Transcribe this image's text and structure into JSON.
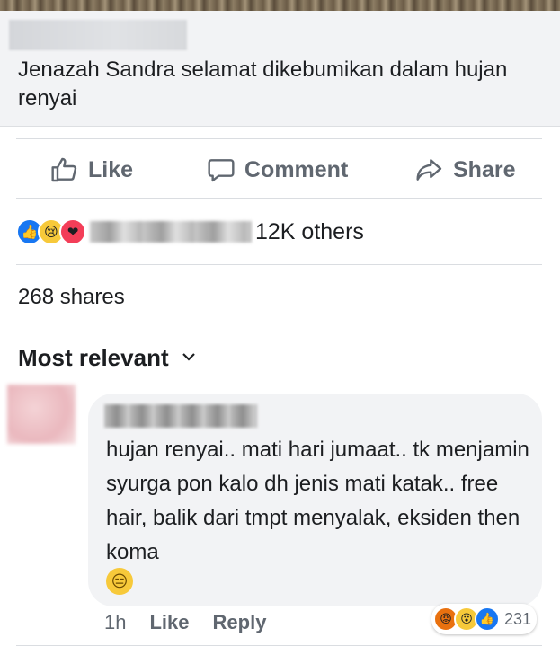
{
  "post": {
    "headline": "Jenazah Sandra selamat dikebumikan dalam hujan renyai"
  },
  "actions": {
    "like_label": "Like",
    "comment_label": "Comment",
    "share_label": "Share"
  },
  "reactions": {
    "icons": [
      "like-icon",
      "sad-icon",
      "love-icon"
    ],
    "others_label": "12K others"
  },
  "shares_label": "268 shares",
  "sort_filter": {
    "label": "Most relevant",
    "icon": "chevron-down-icon"
  },
  "comment": {
    "text": "hujan renyai.. mati hari jumaat.. tk menjamin syurga pon kalo dh jenis mati katak.. free hair, balik dari tmpt menyalak, eksiden then koma",
    "emoji": "😑",
    "time": "1h",
    "like_label": "Like",
    "reply_label": "Reply",
    "reaction_icons": [
      "angry-icon",
      "wow-icon",
      "like-icon"
    ],
    "reaction_count": "231"
  },
  "colors": {
    "accent": "#1877f2",
    "text": "#1c1e21",
    "secondary_text": "#606770",
    "bubble_bg": "#f2f3f5"
  }
}
